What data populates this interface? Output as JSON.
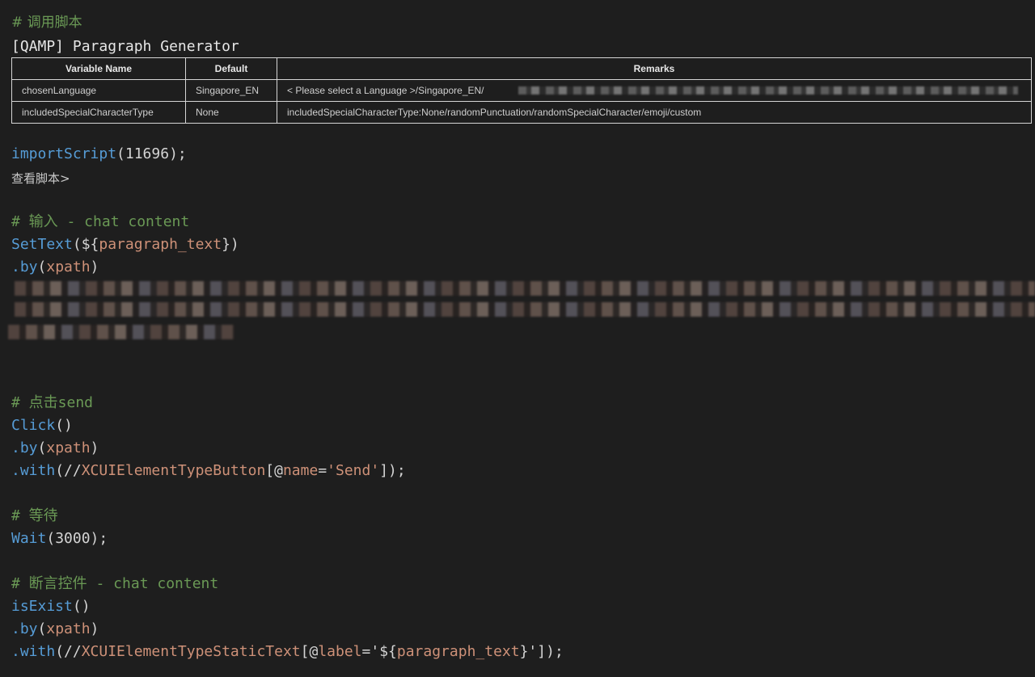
{
  "header": {
    "comment": "# 调用脚本",
    "title": "[QAMP] Paragraph Generator"
  },
  "params_table": {
    "columns": [
      "Variable Name",
      "Default",
      "Remarks"
    ],
    "rows": [
      {
        "name": "chosenLanguage",
        "default": "Singapore_EN",
        "remarks": "< Please select a Language >/Singapore_EN/"
      },
      {
        "name": "includedSpecialCharacterType",
        "default": "None",
        "remarks": "includedSpecialCharacterType:None/randomPunctuation/randomSpecialCharacter/emoji/custom"
      }
    ]
  },
  "code": {
    "import_fn": "importScript",
    "import_args": "(11696);",
    "view_link": "查看脚本>",
    "input_comment": "# 输入 - chat content",
    "settext_fn": "SetText",
    "settext_open": "(${",
    "settext_var": "paragraph_text",
    "settext_close": "})",
    "by1_method": ".by",
    "by1_open": "(",
    "by1_arg": "xpath",
    "by1_close": ")",
    "click_comment": "# 点击send",
    "click_fn": "Click",
    "click_args": "()",
    "by2_method": ".by",
    "by2_open": "(",
    "by2_arg": "xpath",
    "by2_close": ")",
    "with1_method": ".with",
    "with1_open": "(//",
    "with1_type": "XCUIElementTypeButton",
    "with1_bracket": "[@",
    "with1_attr": "name",
    "with1_eq": "=",
    "with1_value": "'Send'",
    "with1_close": "]);",
    "wait_comment": "# 等待",
    "wait_fn": "Wait",
    "wait_args": "(3000);",
    "assert_comment": "# 断言控件 - chat content",
    "exist_fn": "isExist",
    "exist_args": "()",
    "by3_method": ".by",
    "by3_open": "(",
    "by3_arg": "xpath",
    "by3_close": ")",
    "with2_method": ".with",
    "with2_open": "(//",
    "with2_type": "XCUIElementTypeStaticText",
    "with2_bracket": "[@",
    "with2_attr": "label",
    "with2_eq": "=",
    "with2_value_open": "'${",
    "with2_var": "paragraph_text",
    "with2_value_close": "}'",
    "with2_close": "]);"
  }
}
